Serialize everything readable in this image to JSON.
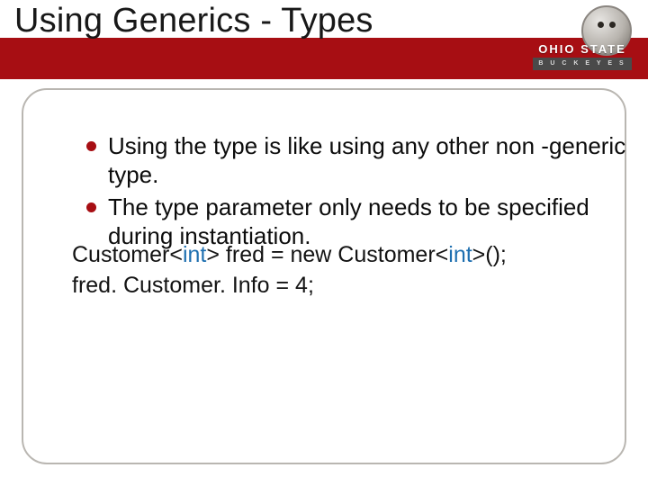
{
  "colors": {
    "accent": "#a70e13",
    "keyword": "#1e6fb0"
  },
  "title": "Using Generics - Types",
  "logo": {
    "primary": "OHIO STATE",
    "secondary": "B U C K E Y E S",
    "mascot": "brutus-buckeye"
  },
  "bullets": [
    "Using the type is like using any other non -generic type.",
    "The type parameter only needs to be specified during instantiation."
  ],
  "code": {
    "line1_a": "Customer<",
    "line1_kw1": "int",
    "line1_b": "> fred = new Customer<",
    "line1_kw2": "int",
    "line1_c": ">();",
    "line2": "fred. Customer. Info = 4;"
  }
}
